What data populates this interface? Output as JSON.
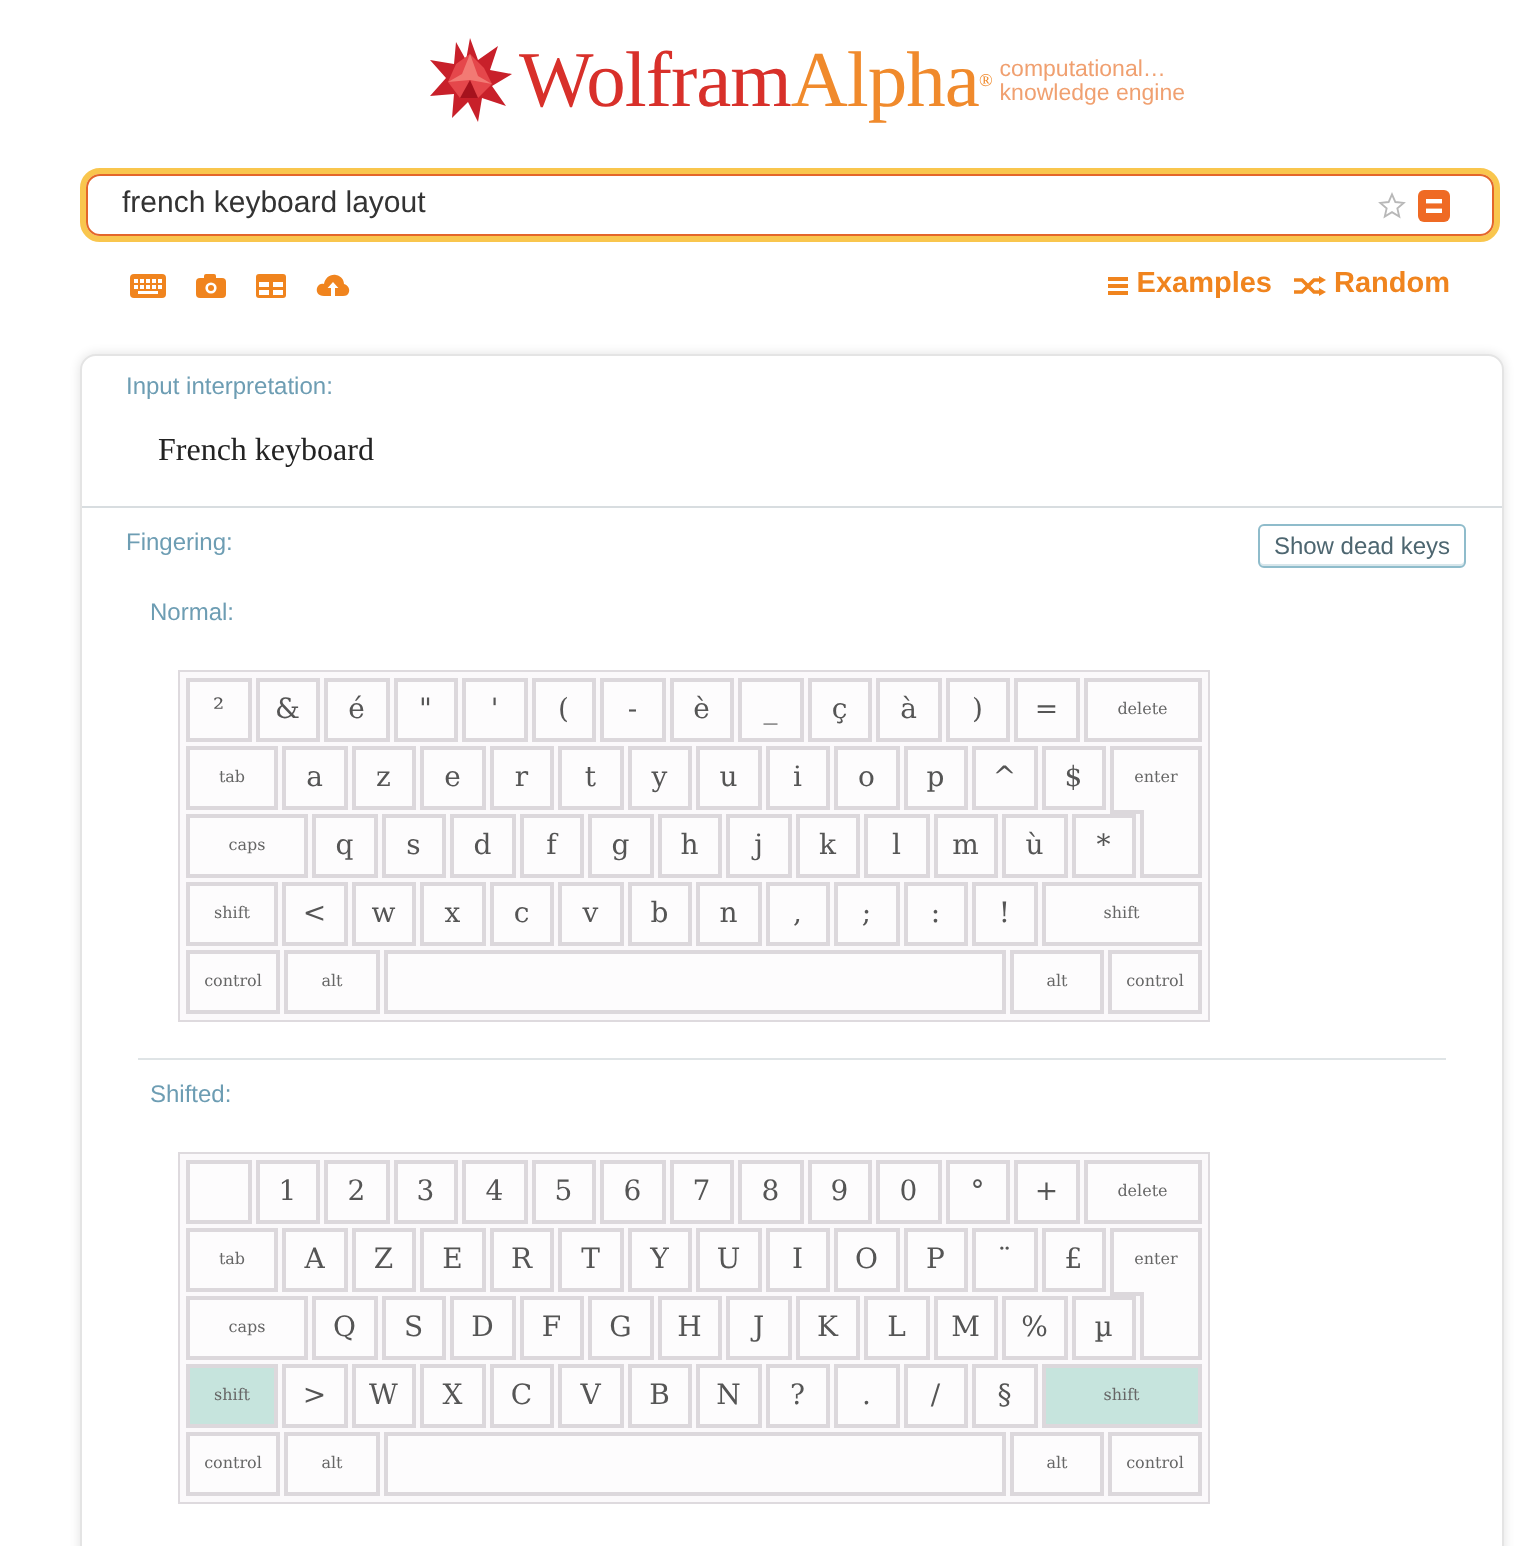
{
  "logo": {
    "name_first": "Wolfram",
    "name_second": "Alpha",
    "mark": "®",
    "tagline": [
      "computational…",
      "knowledge engine"
    ]
  },
  "search": {
    "value": "french keyboard layout"
  },
  "links": [
    {
      "kind": "examples",
      "label": "Examples"
    },
    {
      "kind": "random",
      "label": "Random"
    }
  ],
  "pods": [
    {
      "kind": "text",
      "title": "Input interpretation:",
      "text": "French keyboard"
    },
    {
      "kind": "keyboards",
      "title": "Fingering:",
      "button": "Show dead keys",
      "layouts": [
        {
          "title": "Normal:",
          "rows": [
            {
              "keys": [
                {
                  "kind": "key",
                  "label": "²",
                  "pressed": false
                },
                {
                  "kind": "key",
                  "label": "&",
                  "pressed": false
                },
                {
                  "kind": "key",
                  "label": "é",
                  "pressed": false
                },
                {
                  "kind": "key",
                  "label": "\"",
                  "pressed": false
                },
                {
                  "kind": "key",
                  "label": "'",
                  "pressed": false
                },
                {
                  "kind": "key",
                  "label": "(",
                  "pressed": false
                },
                {
                  "kind": "key",
                  "label": "-",
                  "pressed": false
                },
                {
                  "kind": "key",
                  "label": "è",
                  "pressed": false
                },
                {
                  "kind": "key",
                  "label": "_",
                  "pressed": false
                },
                {
                  "kind": "key",
                  "label": "ç",
                  "pressed": false
                },
                {
                  "kind": "key",
                  "label": "à",
                  "pressed": false
                },
                {
                  "kind": "key",
                  "label": ")",
                  "pressed": false
                },
                {
                  "kind": "key",
                  "label": "=",
                  "pressed": false
                },
                {
                  "kind": "delete",
                  "label": "delete",
                  "pressed": false
                }
              ]
            },
            {
              "keys": [
                {
                  "kind": "tab",
                  "label": "tab",
                  "pressed": false
                },
                {
                  "kind": "key",
                  "label": "a",
                  "pressed": false
                },
                {
                  "kind": "key",
                  "label": "z",
                  "pressed": false
                },
                {
                  "kind": "key",
                  "label": "e",
                  "pressed": false
                },
                {
                  "kind": "key",
                  "label": "r",
                  "pressed": false
                },
                {
                  "kind": "key",
                  "label": "t",
                  "pressed": false
                },
                {
                  "kind": "key",
                  "label": "y",
                  "pressed": false
                },
                {
                  "kind": "key",
                  "label": "u",
                  "pressed": false
                },
                {
                  "kind": "key",
                  "label": "i",
                  "pressed": false
                },
                {
                  "kind": "key",
                  "label": "o",
                  "pressed": false
                },
                {
                  "kind": "key",
                  "label": "p",
                  "pressed": false
                },
                {
                  "kind": "key",
                  "label": "^",
                  "pressed": false
                },
                {
                  "kind": "key",
                  "label": "$",
                  "pressed": false
                },
                {
                  "kind": "enter",
                  "label": "enter",
                  "pressed": false
                }
              ]
            },
            {
              "keys": [
                {
                  "kind": "caps",
                  "label": "caps",
                  "pressed": false
                },
                {
                  "kind": "key",
                  "label": "q",
                  "pressed": false
                },
                {
                  "kind": "key",
                  "label": "s",
                  "pressed": false
                },
                {
                  "kind": "key",
                  "label": "d",
                  "pressed": false
                },
                {
                  "kind": "key",
                  "label": "f",
                  "pressed": false
                },
                {
                  "kind": "key",
                  "label": "g",
                  "pressed": false
                },
                {
                  "kind": "key",
                  "label": "h",
                  "pressed": false
                },
                {
                  "kind": "key",
                  "label": "j",
                  "pressed": false
                },
                {
                  "kind": "key",
                  "label": "k",
                  "pressed": false
                },
                {
                  "kind": "key",
                  "label": "l",
                  "pressed": false
                },
                {
                  "kind": "key",
                  "label": "m",
                  "pressed": false
                },
                {
                  "kind": "key",
                  "label": "ù",
                  "pressed": false
                },
                {
                  "kind": "key",
                  "label": "*",
                  "pressed": false
                }
              ]
            },
            {
              "keys": [
                {
                  "kind": "shift",
                  "label": "shift",
                  "pressed": false
                },
                {
                  "kind": "key",
                  "label": "<",
                  "pressed": false
                },
                {
                  "kind": "key",
                  "label": "w",
                  "pressed": false
                },
                {
                  "kind": "key",
                  "label": "x",
                  "pressed": false
                },
                {
                  "kind": "key",
                  "label": "c",
                  "pressed": false
                },
                {
                  "kind": "key",
                  "label": "v",
                  "pressed": false
                },
                {
                  "kind": "key",
                  "label": "b",
                  "pressed": false
                },
                {
                  "kind": "key",
                  "label": "n",
                  "pressed": false
                },
                {
                  "kind": "key",
                  "label": ",",
                  "pressed": false
                },
                {
                  "kind": "key",
                  "label": ";",
                  "pressed": false
                },
                {
                  "kind": "key",
                  "label": ":",
                  "pressed": false
                },
                {
                  "kind": "key",
                  "label": "!",
                  "pressed": false
                },
                {
                  "kind": "shift",
                  "label": "shift",
                  "pressed": false
                }
              ]
            },
            {
              "keys": [
                {
                  "kind": "control",
                  "label": "control",
                  "pressed": false
                },
                {
                  "kind": "alt",
                  "label": "alt",
                  "pressed": false
                },
                {
                  "kind": "space",
                  "pressed": false
                },
                {
                  "kind": "alt",
                  "label": "alt",
                  "pressed": false
                },
                {
                  "kind": "control",
                  "label": "control",
                  "pressed": false
                }
              ]
            }
          ]
        },
        {
          "title": "Shifted:",
          "rows": [
            {
              "keys": [
                {
                  "kind": "key",
                  "pressed": false
                },
                {
                  "kind": "key",
                  "label": "1",
                  "pressed": false
                },
                {
                  "kind": "key",
                  "label": "2",
                  "pressed": false
                },
                {
                  "kind": "key",
                  "label": "3",
                  "pressed": false
                },
                {
                  "kind": "key",
                  "label": "4",
                  "pressed": false
                },
                {
                  "kind": "key",
                  "label": "5",
                  "pressed": false
                },
                {
                  "kind": "key",
                  "label": "6",
                  "pressed": false
                },
                {
                  "kind": "key",
                  "label": "7",
                  "pressed": false
                },
                {
                  "kind": "key",
                  "label": "8",
                  "pressed": false
                },
                {
                  "kind": "key",
                  "label": "9",
                  "pressed": false
                },
                {
                  "kind": "key",
                  "label": "0",
                  "pressed": false
                },
                {
                  "kind": "key",
                  "label": "°",
                  "pressed": false
                },
                {
                  "kind": "key",
                  "label": "+",
                  "pressed": false
                },
                {
                  "kind": "delete",
                  "label": "delete",
                  "pressed": false
                }
              ]
            },
            {
              "keys": [
                {
                  "kind": "tab",
                  "label": "tab",
                  "pressed": false
                },
                {
                  "kind": "key",
                  "label": "A",
                  "pressed": false
                },
                {
                  "kind": "key",
                  "label": "Z",
                  "pressed": false
                },
                {
                  "kind": "key",
                  "label": "E",
                  "pressed": false
                },
                {
                  "kind": "key",
                  "label": "R",
                  "pressed": false
                },
                {
                  "kind": "key",
                  "label": "T",
                  "pressed": false
                },
                {
                  "kind": "key",
                  "label": "Y",
                  "pressed": false
                },
                {
                  "kind": "key",
                  "label": "U",
                  "pressed": false
                },
                {
                  "kind": "key",
                  "label": "I",
                  "pressed": false
                },
                {
                  "kind": "key",
                  "label": "O",
                  "pressed": false
                },
                {
                  "kind": "key",
                  "label": "P",
                  "pressed": false
                },
                {
                  "kind": "key",
                  "label": "¨",
                  "pressed": false
                },
                {
                  "kind": "key",
                  "label": "£",
                  "pressed": false
                },
                {
                  "kind": "enter",
                  "label": "enter",
                  "pressed": false
                }
              ]
            },
            {
              "keys": [
                {
                  "kind": "caps",
                  "label": "caps",
                  "pressed": false
                },
                {
                  "kind": "key",
                  "label": "Q",
                  "pressed": false
                },
                {
                  "kind": "key",
                  "label": "S",
                  "pressed": false
                },
                {
                  "kind": "key",
                  "label": "D",
                  "pressed": false
                },
                {
                  "kind": "key",
                  "label": "F",
                  "pressed": false
                },
                {
                  "kind": "key",
                  "label": "G",
                  "pressed": false
                },
                {
                  "kind": "key",
                  "label": "H",
                  "pressed": false
                },
                {
                  "kind": "key",
                  "label": "J",
                  "pressed": false
                },
                {
                  "kind": "key",
                  "label": "K",
                  "pressed": false
                },
                {
                  "kind": "key",
                  "label": "L",
                  "pressed": false
                },
                {
                  "kind": "key",
                  "label": "M",
                  "pressed": false
                },
                {
                  "kind": "key",
                  "label": "%",
                  "pressed": false
                },
                {
                  "kind": "key",
                  "label": "µ",
                  "pressed": false
                }
              ]
            },
            {
              "keys": [
                {
                  "kind": "shift",
                  "label": "shift",
                  "pressed": true
                },
                {
                  "kind": "key",
                  "label": ">",
                  "pressed": false
                },
                {
                  "kind": "key",
                  "label": "W",
                  "pressed": false
                },
                {
                  "kind": "key",
                  "label": "X",
                  "pressed": false
                },
                {
                  "kind": "key",
                  "label": "C",
                  "pressed": false
                },
                {
                  "kind": "key",
                  "label": "V",
                  "pressed": false
                },
                {
                  "kind": "key",
                  "label": "B",
                  "pressed": false
                },
                {
                  "kind": "key",
                  "label": "N",
                  "pressed": false
                },
                {
                  "kind": "key",
                  "label": "?",
                  "pressed": false
                },
                {
                  "kind": "key",
                  "label": ".",
                  "pressed": false
                },
                {
                  "kind": "key",
                  "label": "/",
                  "pressed": false
                },
                {
                  "kind": "key",
                  "label": "§",
                  "pressed": false
                },
                {
                  "kind": "shift",
                  "label": "shift",
                  "pressed": true
                }
              ]
            },
            {
              "keys": [
                {
                  "kind": "control",
                  "label": "control",
                  "pressed": false
                },
                {
                  "kind": "alt",
                  "label": "alt",
                  "pressed": false
                },
                {
                  "kind": "space",
                  "pressed": false
                },
                {
                  "kind": "alt",
                  "label": "alt",
                  "pressed": false
                },
                {
                  "kind": "control",
                  "label": "control",
                  "pressed": false
                }
              ]
            }
          ]
        }
      ]
    }
  ]
}
